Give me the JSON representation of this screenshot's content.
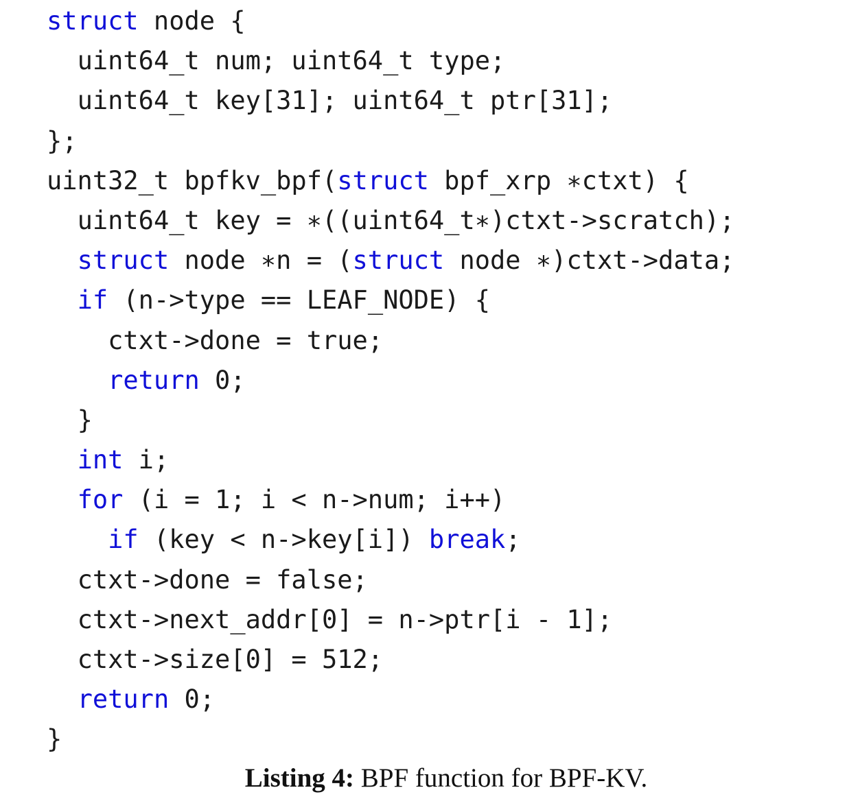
{
  "colors": {
    "keyword": "#1010d8",
    "text": "#1a1a1a"
  },
  "code": {
    "lines": [
      {
        "indent": 0,
        "tokens": [
          {
            "t": "struct",
            "kw": true
          },
          {
            "t": " node {"
          }
        ]
      },
      {
        "indent": 1,
        "tokens": [
          {
            "t": "uint64_t num; uint64_t type;"
          }
        ]
      },
      {
        "indent": 1,
        "tokens": [
          {
            "t": "uint64_t key[31]; uint64_t ptr[31];"
          }
        ]
      },
      {
        "indent": 0,
        "tokens": [
          {
            "t": "};"
          }
        ]
      },
      {
        "indent": 0,
        "tokens": [
          {
            "t": "uint32_t bpfkv_bpf("
          },
          {
            "t": "struct",
            "kw": true
          },
          {
            "t": " bpf_xrp ∗ctxt) {"
          }
        ]
      },
      {
        "indent": 1,
        "tokens": [
          {
            "t": "uint64_t key = ∗((uint64_t∗)ctxt->scratch);"
          }
        ]
      },
      {
        "indent": 1,
        "tokens": [
          {
            "t": "struct",
            "kw": true
          },
          {
            "t": " node ∗n = ("
          },
          {
            "t": "struct",
            "kw": true
          },
          {
            "t": " node ∗)ctxt->data;"
          }
        ]
      },
      {
        "indent": 1,
        "tokens": [
          {
            "t": "if",
            "kw": true
          },
          {
            "t": " (n->type == LEAF_NODE) {"
          }
        ]
      },
      {
        "indent": 2,
        "tokens": [
          {
            "t": "ctxt->done = true;"
          }
        ]
      },
      {
        "indent": 2,
        "tokens": [
          {
            "t": "return",
            "kw": true
          },
          {
            "t": " 0;"
          }
        ]
      },
      {
        "indent": 1,
        "tokens": [
          {
            "t": "}"
          }
        ]
      },
      {
        "indent": 1,
        "tokens": [
          {
            "t": "int",
            "kw": true
          },
          {
            "t": " i;"
          }
        ]
      },
      {
        "indent": 1,
        "tokens": [
          {
            "t": "for",
            "kw": true
          },
          {
            "t": " (i = 1; i < n->num; i++)"
          }
        ]
      },
      {
        "indent": 2,
        "tokens": [
          {
            "t": "if",
            "kw": true
          },
          {
            "t": " (key < n->key[i]) "
          },
          {
            "t": "break",
            "kw": true
          },
          {
            "t": ";"
          }
        ]
      },
      {
        "indent": 1,
        "tokens": [
          {
            "t": "ctxt->done = false;"
          }
        ]
      },
      {
        "indent": 1,
        "tokens": [
          {
            "t": "ctxt->next_addr[0] = n->ptr[i - 1];"
          }
        ]
      },
      {
        "indent": 1,
        "tokens": [
          {
            "t": "ctxt->size[0] = 512;"
          }
        ]
      },
      {
        "indent": 1,
        "tokens": [
          {
            "t": "return",
            "kw": true
          },
          {
            "t": " 0;"
          }
        ]
      },
      {
        "indent": 0,
        "tokens": [
          {
            "t": "}"
          }
        ]
      }
    ]
  },
  "caption": {
    "label": "Listing 4:",
    "text": " BPF function for BPF-KV."
  }
}
